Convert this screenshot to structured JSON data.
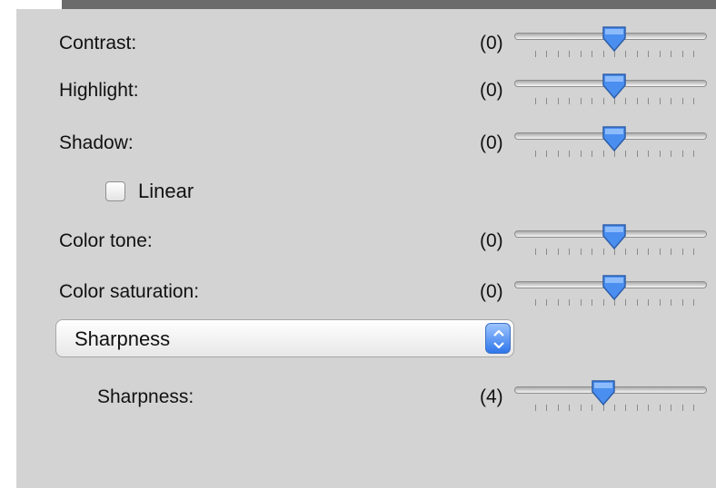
{
  "panel": {
    "adjustments": [
      {
        "label": "Contrast:",
        "value": "(0)",
        "level": 0.5
      },
      {
        "label": "Highlight:",
        "value": "(0)",
        "level": 0.5
      },
      {
        "label": "Shadow:",
        "value": "(0)",
        "level": 0.5
      },
      {
        "label": "Color tone:",
        "value": "(0)",
        "level": 0.5
      },
      {
        "label": "Color saturation:",
        "value": "(0)",
        "level": 0.5
      }
    ],
    "linear": {
      "label": "Linear",
      "checked": false
    },
    "mode_popup": {
      "selected": "Sharpness"
    },
    "sharpness": {
      "label": "Sharpness:",
      "value": "(4)",
      "level": 0.4286
    }
  },
  "colors": {
    "panel_bg": "#d3d3d3",
    "knob_fill": "#4a8ef0",
    "accent": "#2f76ea"
  },
  "icons": {
    "slider_knob": "slider-thumb-icon",
    "popup_arrows": "up-down-chevron-icon"
  }
}
